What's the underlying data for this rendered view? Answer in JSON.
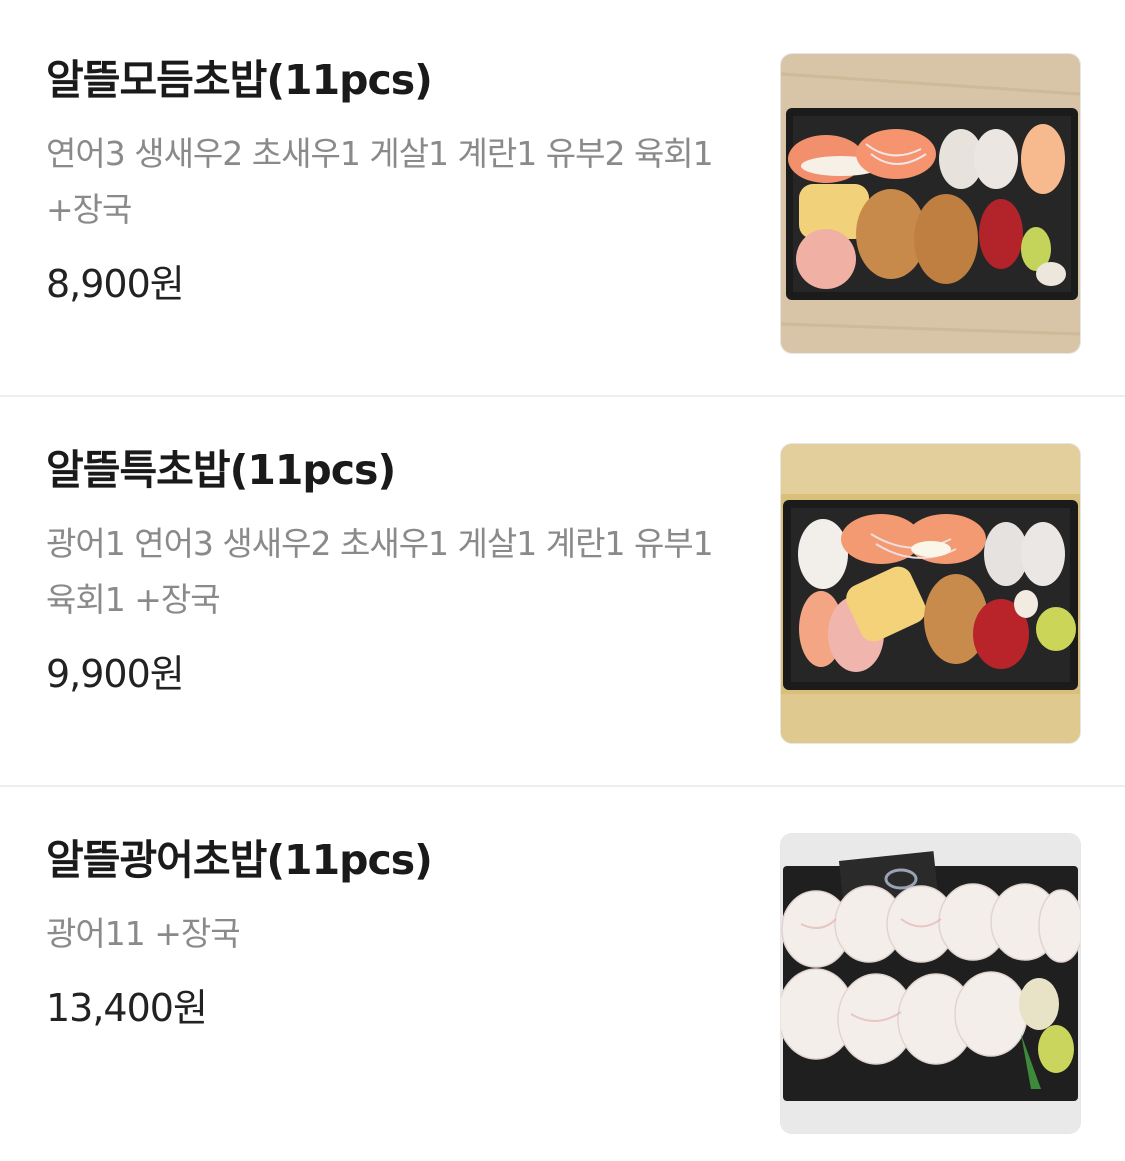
{
  "menu": {
    "items": [
      {
        "name": "알뜰모듬초밥(11pcs)",
        "description": "연어3 생새우2 초새우1 게살1 계란1 유부2 육회1 +장국",
        "price": "8,900원",
        "image": "assorted-sushi-photo"
      },
      {
        "name": "알뜰특초밥(11pcs)",
        "description": "광어1 연어3 생새우2 초새우1 게살1 계란1 유부1 육회1 +장국",
        "price": "9,900원",
        "image": "special-sushi-photo"
      },
      {
        "name": "알뜰광어초밥(11pcs)",
        "description": "광어11 +장국",
        "price": "13,400원",
        "image": "flatfish-sushi-photo"
      }
    ]
  },
  "colors": {
    "title": "#1a1a1a",
    "description": "#8a8a8a",
    "price": "#222222",
    "divider": "#eeeeee"
  }
}
